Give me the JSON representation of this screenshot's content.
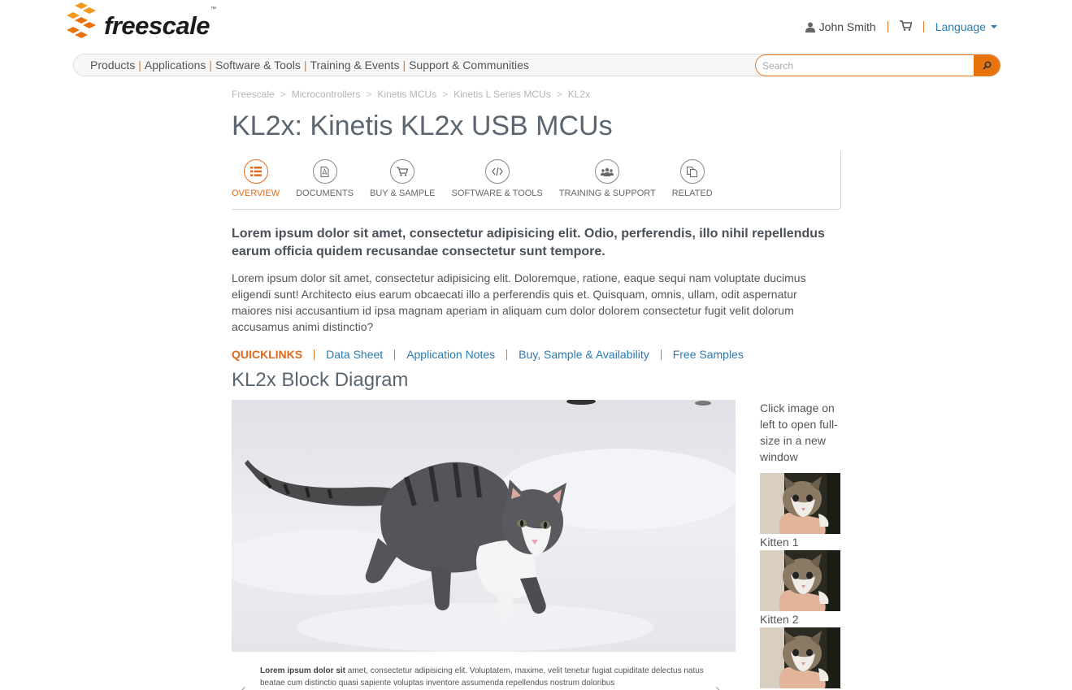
{
  "brand": {
    "name": "freescale",
    "tm": "™",
    "colors": {
      "accent": "#e8720c",
      "link": "#2a7ab0",
      "title": "#5c6670"
    }
  },
  "header": {
    "user_name": "John Smith",
    "user_icon": "user-icon",
    "cart_icon": "cart-icon",
    "language_label": "Language"
  },
  "nav": {
    "items": [
      {
        "label": "Products"
      },
      {
        "label": "Applications"
      },
      {
        "label": "Software & Tools"
      },
      {
        "label": "Training & Events"
      },
      {
        "label": "Support & Communities"
      }
    ],
    "separator": "|",
    "search_placeholder": "Search",
    "search_icon": "search-icon"
  },
  "breadcrumb": {
    "items": [
      "Freescale",
      "Microcontrollers",
      "Kinetis MCUs",
      "Kinetis L Series MCUs",
      "KL2x"
    ],
    "separator": ">"
  },
  "page": {
    "title": "KL2x: Kinetis KL2x USB MCUs"
  },
  "tabs": [
    {
      "label": "OVERVIEW",
      "icon": "list-icon",
      "active": true
    },
    {
      "label": "DOCUMENTS",
      "icon": "pdf-icon",
      "active": false
    },
    {
      "label": "BUY & SAMPLE",
      "icon": "cart-icon",
      "active": false
    },
    {
      "label": "SOFTWARE & TOOLS",
      "icon": "code-icon",
      "active": false
    },
    {
      "label": "TRAINING & SUPPORT",
      "icon": "people-icon",
      "active": false
    },
    {
      "label": "RELATED",
      "icon": "copy-icon",
      "active": false
    }
  ],
  "content": {
    "lead": "Lorem ipsum dolor sit amet, consectetur adipisicing elit. Odio, perferendis, illo nihil repellendus earum officia quidem recusandae consectetur sunt tempore.",
    "body": "Lorem ipsum dolor sit amet, consectetur adipisicing elit. Doloremque, ratione, eaque sequi nam voluptate ducimus eligendi sunt! Architecto eius earum obcaecati illo a perferendis quis et. Quisquam, omnis, ullam, odit aspernatur maiores nisi accusantium id ipsa magnam aperiam in aliquam cum dolor dolorem consectetur fugit velit dolorum accusamus animi distinctio?"
  },
  "quicklinks": {
    "title": "QUICKLINKS",
    "links": [
      "Data Sheet",
      "Application Notes",
      "Buy, Sample & Availability",
      "Free Samples"
    ]
  },
  "diagram": {
    "title": "KL2x Block Diagram",
    "side_note": "Click image on left to open full-size in a new window",
    "caption_bold": "Lorem ipsum dolor sit",
    "caption_rest": " amet, consectetur adipisicing elit. Voluptatem, maxime, velit tenetur fugiat cupiditate delectus natus beatae cum distinctio quasi sapiente voluptas inventore assumenda repellendus nostrum doloribus",
    "thumbs": [
      {
        "label": "Kitten 1"
      },
      {
        "label": "Kitten 2"
      },
      {
        "label": ""
      }
    ],
    "prev_arrow": "‹",
    "next_arrow": "›"
  }
}
